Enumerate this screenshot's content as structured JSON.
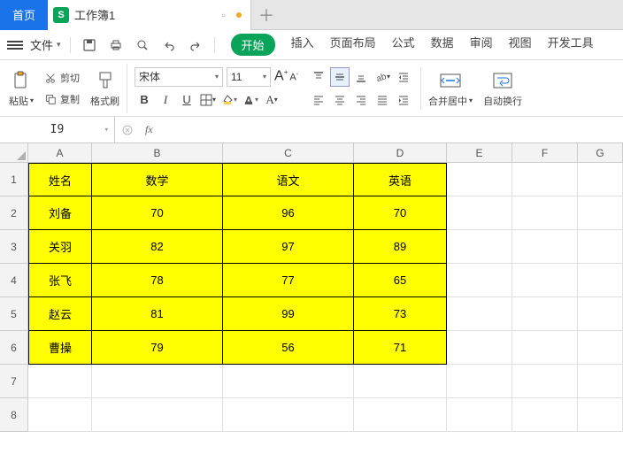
{
  "tabs": {
    "home": "首页",
    "workbook_label": "工作簿1",
    "s_icon": "S"
  },
  "menu": {
    "file": "文件",
    "start": "开始",
    "insert": "插入",
    "page_layout": "页面布局",
    "formula": "公式",
    "data": "数据",
    "review": "审阅",
    "view": "视图",
    "dev": "开发工具"
  },
  "toolbar": {
    "paste": "粘贴",
    "cut": "剪切",
    "copy": "复制",
    "format_painter": "格式刷",
    "font_name": "宋体",
    "font_size": "11",
    "merge_center": "合并居中",
    "auto_wrap": "自动换行"
  },
  "namebox": "I9",
  "columns": [
    "A",
    "B",
    "C",
    "D",
    "E",
    "F",
    "G"
  ],
  "rows": [
    "1",
    "2",
    "3",
    "4",
    "5",
    "6",
    "7",
    "8"
  ],
  "table": [
    [
      "姓名",
      "数学",
      "语文",
      "英语"
    ],
    [
      "刘备",
      "70",
      "96",
      "70"
    ],
    [
      "关羽",
      "82",
      "97",
      "89"
    ],
    [
      "张飞",
      "78",
      "77",
      "65"
    ],
    [
      "赵云",
      "81",
      "99",
      "73"
    ],
    [
      "曹操",
      "79",
      "56",
      "71"
    ]
  ],
  "chart_data": {
    "type": "table",
    "title": "",
    "columns": [
      "姓名",
      "数学",
      "语文",
      "英语"
    ],
    "rows": [
      {
        "姓名": "刘备",
        "数学": 70,
        "语文": 96,
        "英语": 70
      },
      {
        "姓名": "关羽",
        "数学": 82,
        "语文": 97,
        "英语": 89
      },
      {
        "姓名": "张飞",
        "数学": 78,
        "语文": 77,
        "英语": 65
      },
      {
        "姓名": "赵云",
        "数学": 81,
        "语文": 99,
        "英语": 73
      },
      {
        "姓名": "曹操",
        "数学": 79,
        "语文": 56,
        "英语": 71
      }
    ]
  }
}
